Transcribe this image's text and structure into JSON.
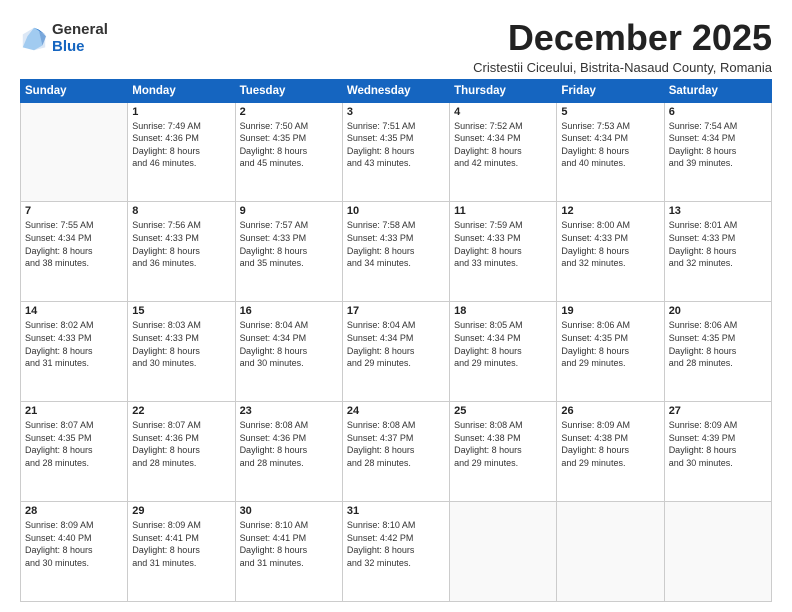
{
  "logo": {
    "general": "General",
    "blue": "Blue"
  },
  "title": "December 2025",
  "subtitle": "Cristestii Ciceului, Bistrita-Nasaud County, Romania",
  "weekdays": [
    "Sunday",
    "Monday",
    "Tuesday",
    "Wednesday",
    "Thursday",
    "Friday",
    "Saturday"
  ],
  "weeks": [
    [
      {
        "day": "",
        "info": ""
      },
      {
        "day": "1",
        "info": "Sunrise: 7:49 AM\nSunset: 4:36 PM\nDaylight: 8 hours\nand 46 minutes."
      },
      {
        "day": "2",
        "info": "Sunrise: 7:50 AM\nSunset: 4:35 PM\nDaylight: 8 hours\nand 45 minutes."
      },
      {
        "day": "3",
        "info": "Sunrise: 7:51 AM\nSunset: 4:35 PM\nDaylight: 8 hours\nand 43 minutes."
      },
      {
        "day": "4",
        "info": "Sunrise: 7:52 AM\nSunset: 4:34 PM\nDaylight: 8 hours\nand 42 minutes."
      },
      {
        "day": "5",
        "info": "Sunrise: 7:53 AM\nSunset: 4:34 PM\nDaylight: 8 hours\nand 40 minutes."
      },
      {
        "day": "6",
        "info": "Sunrise: 7:54 AM\nSunset: 4:34 PM\nDaylight: 8 hours\nand 39 minutes."
      }
    ],
    [
      {
        "day": "7",
        "info": "Sunrise: 7:55 AM\nSunset: 4:34 PM\nDaylight: 8 hours\nand 38 minutes."
      },
      {
        "day": "8",
        "info": "Sunrise: 7:56 AM\nSunset: 4:33 PM\nDaylight: 8 hours\nand 36 minutes."
      },
      {
        "day": "9",
        "info": "Sunrise: 7:57 AM\nSunset: 4:33 PM\nDaylight: 8 hours\nand 35 minutes."
      },
      {
        "day": "10",
        "info": "Sunrise: 7:58 AM\nSunset: 4:33 PM\nDaylight: 8 hours\nand 34 minutes."
      },
      {
        "day": "11",
        "info": "Sunrise: 7:59 AM\nSunset: 4:33 PM\nDaylight: 8 hours\nand 33 minutes."
      },
      {
        "day": "12",
        "info": "Sunrise: 8:00 AM\nSunset: 4:33 PM\nDaylight: 8 hours\nand 32 minutes."
      },
      {
        "day": "13",
        "info": "Sunrise: 8:01 AM\nSunset: 4:33 PM\nDaylight: 8 hours\nand 32 minutes."
      }
    ],
    [
      {
        "day": "14",
        "info": "Sunrise: 8:02 AM\nSunset: 4:33 PM\nDaylight: 8 hours\nand 31 minutes."
      },
      {
        "day": "15",
        "info": "Sunrise: 8:03 AM\nSunset: 4:33 PM\nDaylight: 8 hours\nand 30 minutes."
      },
      {
        "day": "16",
        "info": "Sunrise: 8:04 AM\nSunset: 4:34 PM\nDaylight: 8 hours\nand 30 minutes."
      },
      {
        "day": "17",
        "info": "Sunrise: 8:04 AM\nSunset: 4:34 PM\nDaylight: 8 hours\nand 29 minutes."
      },
      {
        "day": "18",
        "info": "Sunrise: 8:05 AM\nSunset: 4:34 PM\nDaylight: 8 hours\nand 29 minutes."
      },
      {
        "day": "19",
        "info": "Sunrise: 8:06 AM\nSunset: 4:35 PM\nDaylight: 8 hours\nand 29 minutes."
      },
      {
        "day": "20",
        "info": "Sunrise: 8:06 AM\nSunset: 4:35 PM\nDaylight: 8 hours\nand 28 minutes."
      }
    ],
    [
      {
        "day": "21",
        "info": "Sunrise: 8:07 AM\nSunset: 4:35 PM\nDaylight: 8 hours\nand 28 minutes."
      },
      {
        "day": "22",
        "info": "Sunrise: 8:07 AM\nSunset: 4:36 PM\nDaylight: 8 hours\nand 28 minutes."
      },
      {
        "day": "23",
        "info": "Sunrise: 8:08 AM\nSunset: 4:36 PM\nDaylight: 8 hours\nand 28 minutes."
      },
      {
        "day": "24",
        "info": "Sunrise: 8:08 AM\nSunset: 4:37 PM\nDaylight: 8 hours\nand 28 minutes."
      },
      {
        "day": "25",
        "info": "Sunrise: 8:08 AM\nSunset: 4:38 PM\nDaylight: 8 hours\nand 29 minutes."
      },
      {
        "day": "26",
        "info": "Sunrise: 8:09 AM\nSunset: 4:38 PM\nDaylight: 8 hours\nand 29 minutes."
      },
      {
        "day": "27",
        "info": "Sunrise: 8:09 AM\nSunset: 4:39 PM\nDaylight: 8 hours\nand 30 minutes."
      }
    ],
    [
      {
        "day": "28",
        "info": "Sunrise: 8:09 AM\nSunset: 4:40 PM\nDaylight: 8 hours\nand 30 minutes."
      },
      {
        "day": "29",
        "info": "Sunrise: 8:09 AM\nSunset: 4:41 PM\nDaylight: 8 hours\nand 31 minutes."
      },
      {
        "day": "30",
        "info": "Sunrise: 8:10 AM\nSunset: 4:41 PM\nDaylight: 8 hours\nand 31 minutes."
      },
      {
        "day": "31",
        "info": "Sunrise: 8:10 AM\nSunset: 4:42 PM\nDaylight: 8 hours\nand 32 minutes."
      },
      {
        "day": "",
        "info": ""
      },
      {
        "day": "",
        "info": ""
      },
      {
        "day": "",
        "info": ""
      }
    ]
  ]
}
